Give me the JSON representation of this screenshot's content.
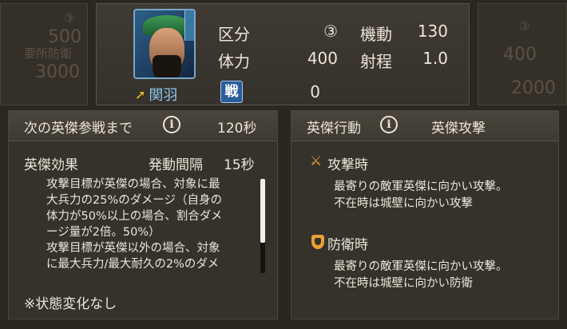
{
  "header": {
    "hero_name": "関羽",
    "battle_badge": "戦",
    "battle_value": "0",
    "stats": {
      "category_label": "区分",
      "category_value": "③",
      "mobility_label": "機動",
      "mobility_value": "130",
      "troops_label": "体力",
      "troops_value": "400",
      "range_label": "射程",
      "range_value": "1.0"
    }
  },
  "left_panel": {
    "title": "次の英傑参戦まで",
    "countdown": "120秒",
    "effect_title": "英傑効果",
    "interval_label": "発動間隔",
    "interval_value": "15秒",
    "effect_lines": [
      "攻撃目標が英傑の場合、対象に最",
      "大兵力の25%のダメージ（自身の",
      "体力が50%以上の場合、割合ダメ",
      "ージ量が2倍。50%）",
      "攻撃目標が英傑以外の場合、対象",
      "に最大兵力/最大耐久の2%のダメ"
    ],
    "footer_note": "※状態変化なし"
  },
  "right_panel": {
    "title": "英傑行動",
    "action_name": "英傑攻撃",
    "attack_title": "攻撃時",
    "attack_lines": [
      "最寄りの敵軍英傑に向かい攻撃。",
      "不在時は城壁に向かい攻撃"
    ],
    "defense_title": "防衛時",
    "defense_lines": [
      "最寄りの敵軍英傑に向かい攻撃。",
      "不在時は城壁に向かい防衛"
    ]
  },
  "background": {
    "left_small": "③",
    "left_value": "500",
    "left_label": "要所防衛",
    "left_value2": "3000",
    "right_small": "③",
    "right_value": "400",
    "right_value2": "2000"
  },
  "colors": {
    "accent_orange": "#e8a034",
    "name_blue": "#8ec8f0",
    "text": "#ece6d8"
  },
  "scroll_position": 0
}
